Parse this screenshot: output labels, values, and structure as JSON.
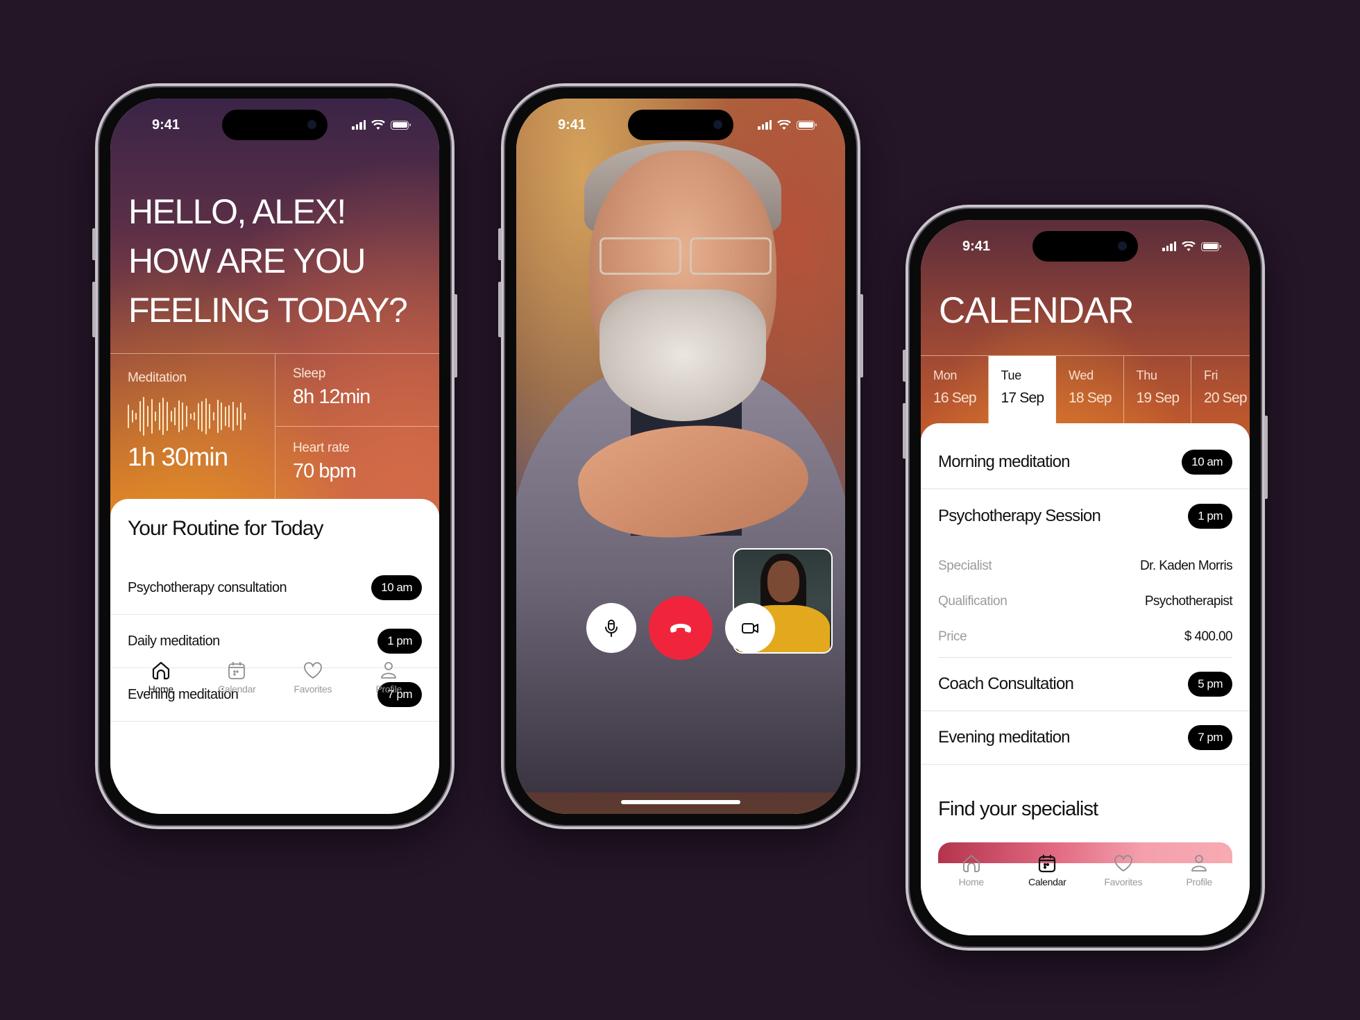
{
  "status_bar": {
    "time": "9:41"
  },
  "home": {
    "greeting_lines": [
      "HELLO, ALEX!",
      "HOW ARE YOU",
      "FEELING TODAY?"
    ],
    "stats": {
      "meditation": {
        "label": "Meditation",
        "value": "1h 30min"
      },
      "sleep": {
        "label": "Sleep",
        "value": "8h 12min"
      },
      "heart_rate": {
        "label": "Heart rate",
        "value": "70 bpm"
      }
    },
    "routine_title": "Your Routine for Today",
    "routine": [
      {
        "label": "Psychotherapy consultation",
        "time": "10 am"
      },
      {
        "label": "Daily meditation",
        "time": "1 pm"
      },
      {
        "label": "Evening meditation",
        "time": "7 pm"
      }
    ]
  },
  "tabbar": {
    "items": [
      {
        "label": "Home",
        "icon": "home-icon"
      },
      {
        "label": "Calendar",
        "icon": "calendar-icon"
      },
      {
        "label": "Favorites",
        "icon": "heart-icon"
      },
      {
        "label": "Profile",
        "icon": "user-icon"
      }
    ]
  },
  "call": {
    "controls": [
      {
        "name": "mute",
        "icon": "microphone-icon"
      },
      {
        "name": "end-call",
        "icon": "phone-hangup-icon",
        "color": "#f0253c"
      },
      {
        "name": "video",
        "icon": "video-camera-icon"
      }
    ]
  },
  "calendar": {
    "title": "CALENDAR",
    "days": [
      {
        "name": "Mon",
        "date": "16 Sep",
        "active": false
      },
      {
        "name": "Tue",
        "date": "17 Sep",
        "active": true
      },
      {
        "name": "Wed",
        "date": "18 Sep",
        "active": false
      },
      {
        "name": "Thu",
        "date": "19 Sep",
        "active": false
      },
      {
        "name": "Fri",
        "date": "20 Sep",
        "active": false
      }
    ],
    "events": [
      {
        "label": "Morning meditation",
        "time": "10 am"
      },
      {
        "label": "Psychotherapy Session",
        "time": "1 pm"
      },
      {
        "label": "Coach Consultation",
        "time": "5 pm"
      },
      {
        "label": "Evening meditation",
        "time": "7 pm"
      }
    ],
    "session_details": [
      {
        "key": "Specialist",
        "value": "Dr. Kaden Morris"
      },
      {
        "key": "Qualification",
        "value": "Psychotherapist"
      },
      {
        "key": "Price",
        "value": "$ 400.00"
      }
    ],
    "specialist_title": "Find your specialist"
  },
  "colors": {
    "background": "#241527",
    "accent_end_call": "#f0253c",
    "pill": "#000000",
    "tab_inactive": "#9a9a9a"
  }
}
